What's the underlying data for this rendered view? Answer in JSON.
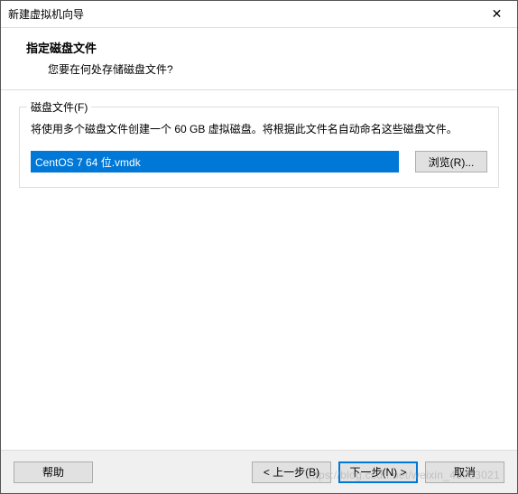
{
  "titlebar": {
    "title": "新建虚拟机向导",
    "close_icon": "✕"
  },
  "header": {
    "title": "指定磁盘文件",
    "subtitle": "您要在何处存储磁盘文件?"
  },
  "fieldset": {
    "legend": "磁盘文件(F)",
    "description": "将使用多个磁盘文件创建一个 60 GB 虚拟磁盘。将根据此文件名自动命名这些磁盘文件。",
    "input_value": "CentOS 7 64 位.vmdk",
    "browse_label": "浏览(R)..."
  },
  "footer": {
    "help_label": "帮助",
    "back_label": "< 上一步(B)",
    "next_label": "下一步(N) >",
    "cancel_label": "取消"
  },
  "watermark": "https://blog.csdn.net/weixin_43933021"
}
